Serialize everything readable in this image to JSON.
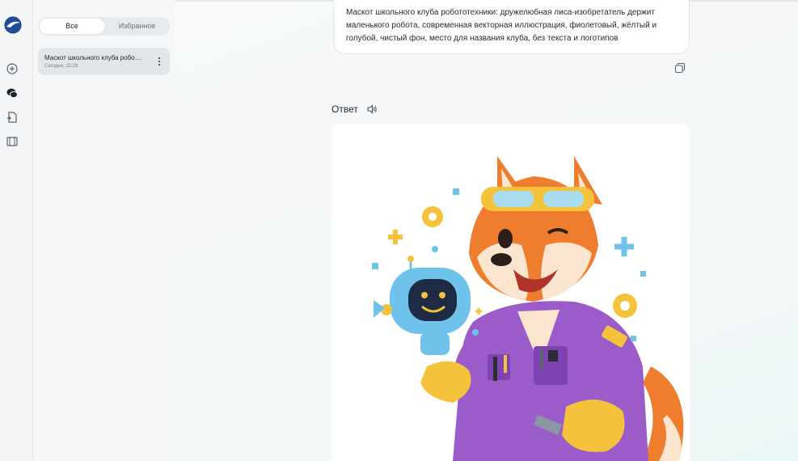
{
  "segmented": {
    "all": "Все",
    "favorites": "Избранное"
  },
  "history": [
    {
      "title": "Маскот школьного клуба робо…",
      "date": "Сегодня, 15:29"
    }
  ],
  "prompt": {
    "text": "Маскот школьного клуба робототехники: дружелюбная лиса-изобретатель держит маленького робота, современная векторная иллюстрация, фиолетовый, жёлтый и голубой, чистый фон, место для названия клуба, без текста и логотипов"
  },
  "answer": {
    "label": "Ответ"
  },
  "colors": {
    "accent_blue": "#1f4f9c",
    "fox_orange": "#ef7d2e",
    "suit_purple": "#9b5cc9",
    "gear_yellow": "#f5c33b",
    "robot_blue": "#6fc3ea"
  },
  "icons": [
    "logo-icon",
    "new-chat-icon",
    "chats-icon",
    "file-icon",
    "film-icon",
    "kebab-icon",
    "copy-icon",
    "speaker-icon"
  ]
}
